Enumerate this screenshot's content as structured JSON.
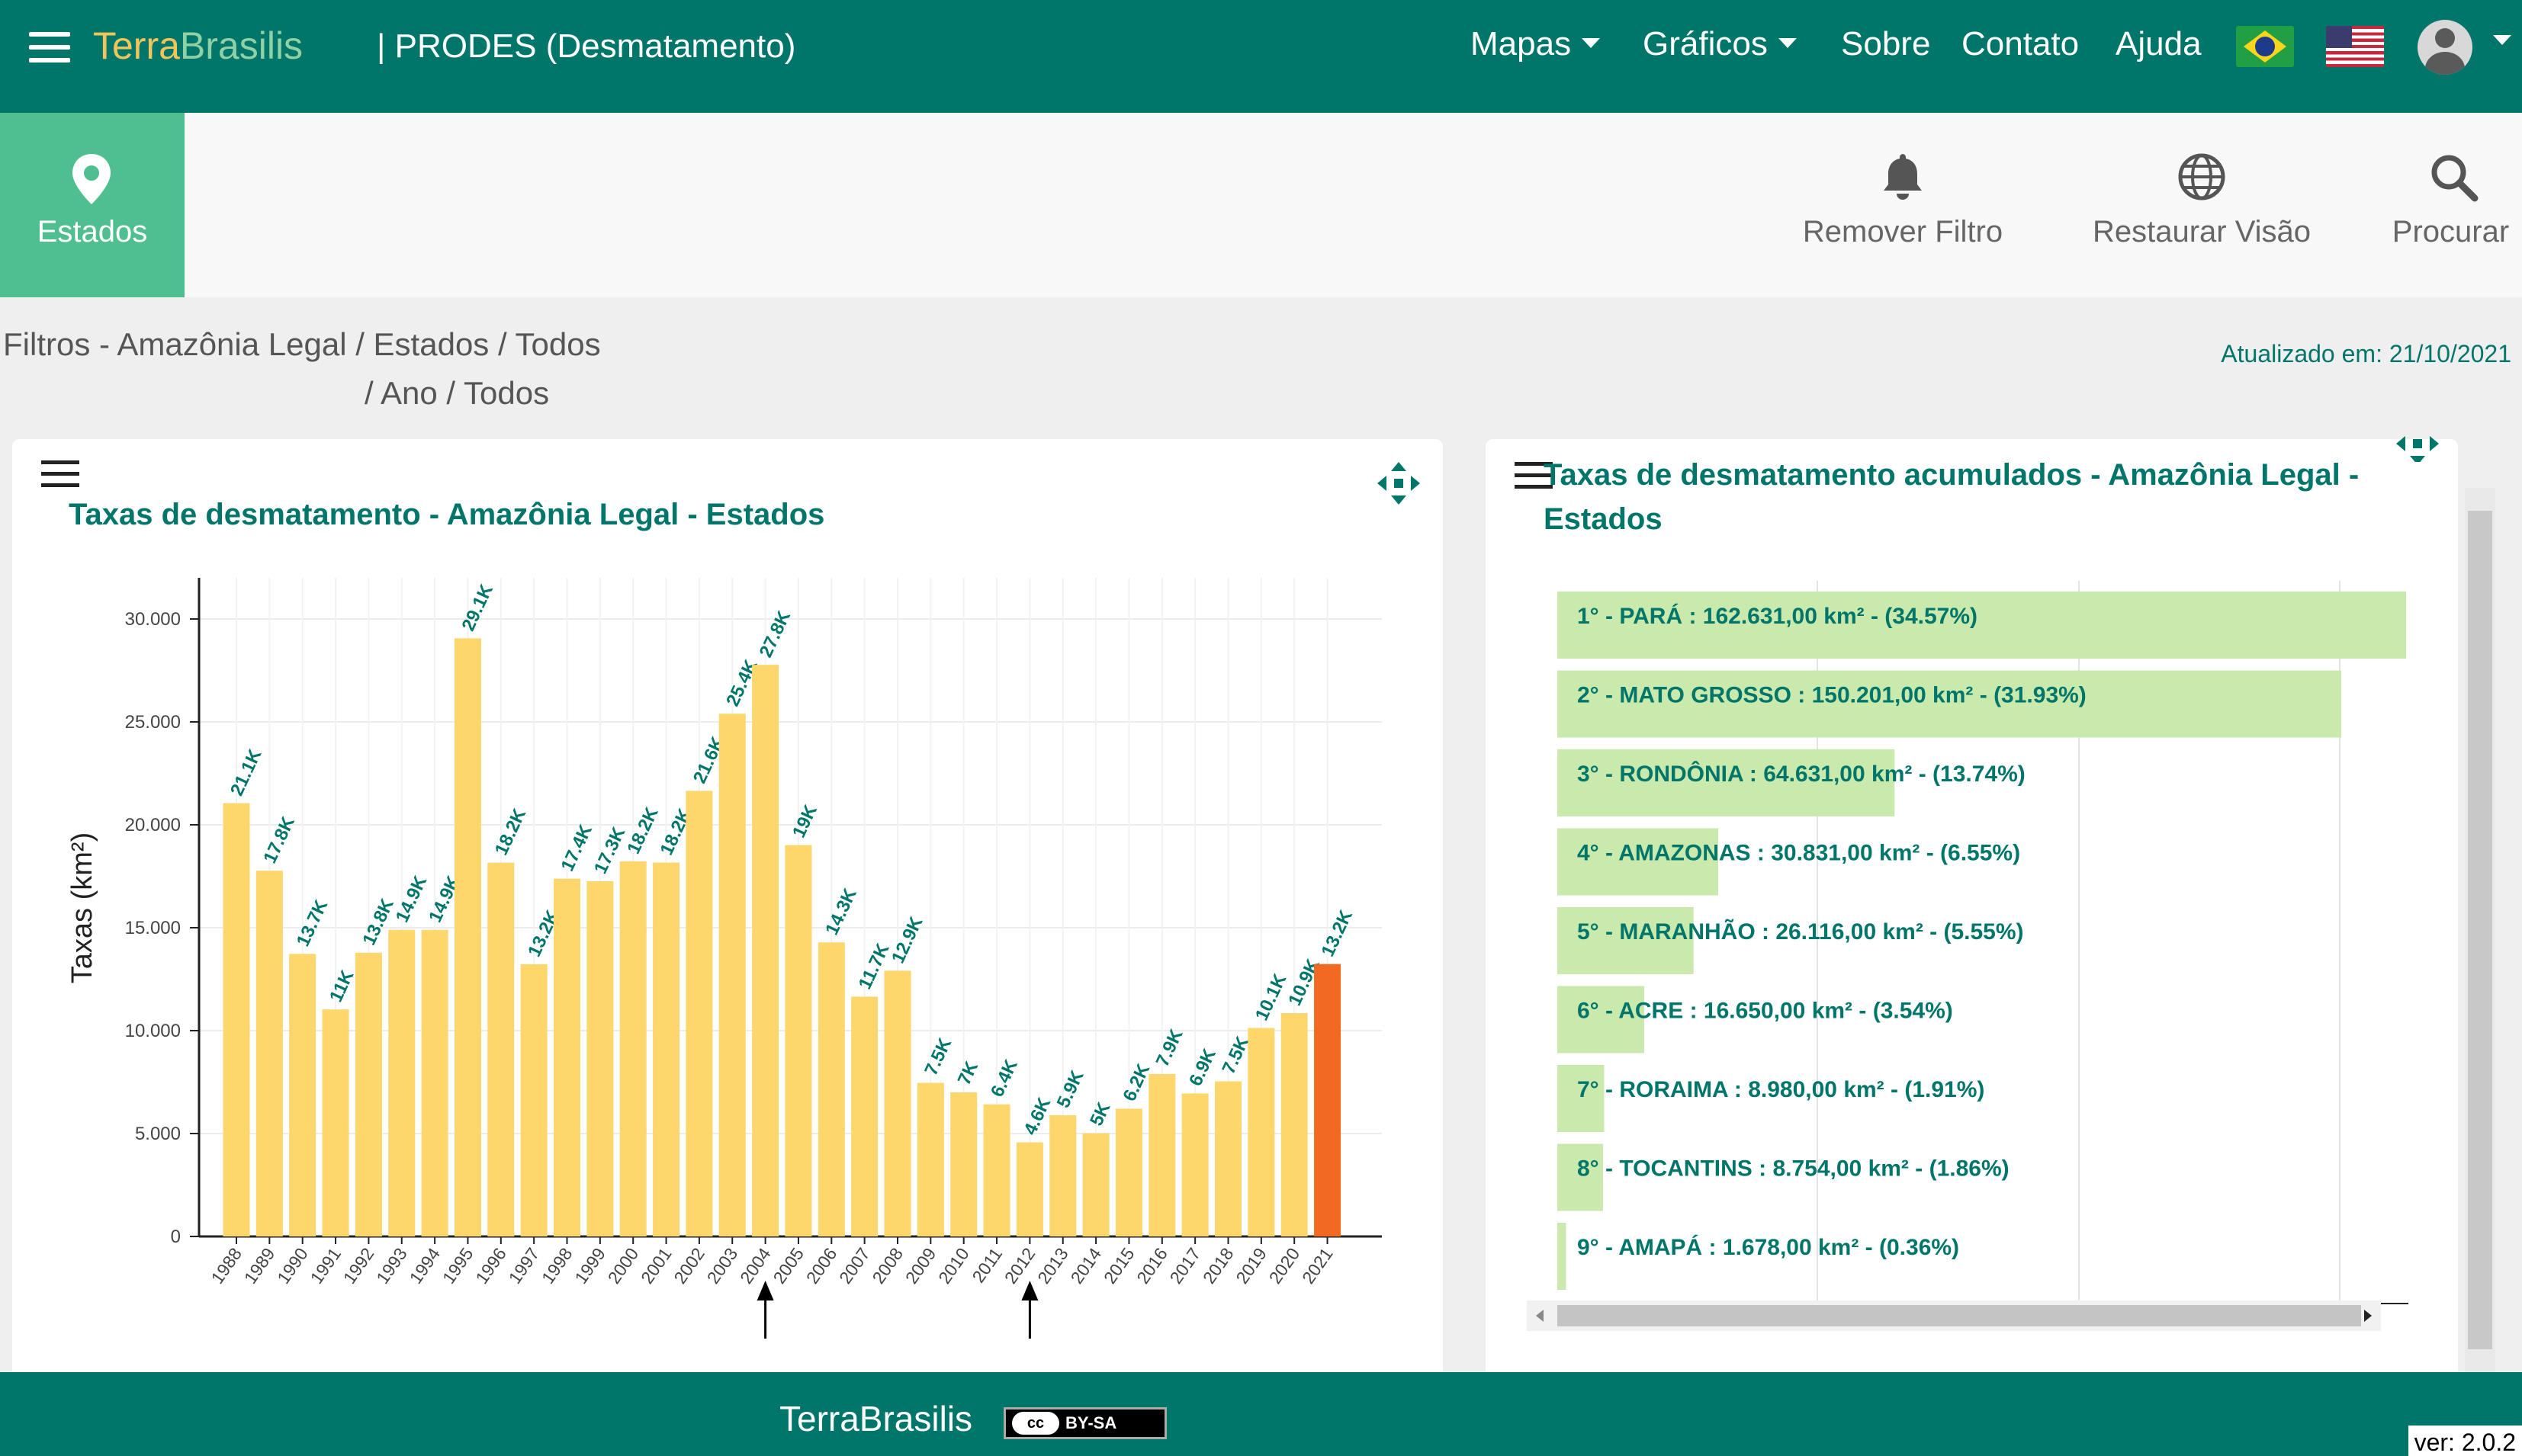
{
  "navbar": {
    "brand_part1": "Terra",
    "brand_part2": "Brasilis",
    "product": "| PRODES (Desmatamento)",
    "links": {
      "maps": "Mapas",
      "charts": "Gráficos",
      "about": "Sobre",
      "contact": "Contato",
      "help": "Ajuda"
    }
  },
  "toolbar": {
    "states": "Estados",
    "remove_filter": "Remover Filtro",
    "restore_view": "Restaurar Visão",
    "search": "Procurar"
  },
  "filters": {
    "line1": "Filtros - Amazônia Legal / Estados / Todos",
    "line2": "/ Ano / Todos",
    "updated": "Atualizado em: 21/10/2021"
  },
  "left_panel": {
    "title": "Taxas de desmatamento - Amazônia Legal - Estados"
  },
  "right_panel": {
    "title_line1": "Taxas de desmatamento acumulados - Amazônia Legal -",
    "title_line2": "Estados"
  },
  "colors": {
    "primary": "#00766a",
    "bar": "#fdd66c",
    "highlight_bar": "#f26a22",
    "hbar": "#c9e9ad",
    "states_tab": "#4fbf8f"
  },
  "chart_data": [
    {
      "type": "bar",
      "ylabel": "Taxas (km²)",
      "ylim": [
        0,
        32000
      ],
      "yticks": [
        0,
        5000,
        10000,
        15000,
        20000,
        25000,
        30000
      ],
      "ytick_labels": [
        "0",
        "5.000",
        "10.000",
        "15.000",
        "20.000",
        "25.000",
        "30.000"
      ],
      "categories": [
        "1988",
        "1989",
        "1990",
        "1991",
        "1992",
        "1993",
        "1994",
        "1995",
        "1996",
        "1997",
        "1998",
        "1999",
        "2000",
        "2001",
        "2002",
        "2003",
        "2004",
        "2005",
        "2006",
        "2007",
        "2008",
        "2009",
        "2010",
        "2011",
        "2012",
        "2013",
        "2014",
        "2015",
        "2016",
        "2017",
        "2018",
        "2019",
        "2020",
        "2021"
      ],
      "values": [
        21050,
        17770,
        13730,
        11030,
        13786,
        14896,
        14896,
        29059,
        18161,
        13227,
        17383,
        17259,
        18226,
        18165,
        21651,
        25396,
        27772,
        19014,
        14286,
        11651,
        12911,
        7464,
        7000,
        6418,
        4571,
        5891,
        5012,
        6207,
        7893,
        6947,
        7536,
        10129,
        10851,
        13235
      ],
      "data_labels": [
        "21.1K",
        "17.8K",
        "13.7K",
        "11K",
        "13.8K",
        "14.9K",
        "14.9K",
        "29.1K",
        "18.2K",
        "13.2K",
        "17.4K",
        "17.3K",
        "18.2K",
        "18.2K",
        "21.6K",
        "25.4K",
        "27.8K",
        "19K",
        "14.3K",
        "11.7K",
        "12.9K",
        "7.5K",
        "7K",
        "6.4K",
        "4.6K",
        "5.9K",
        "5K",
        "6.2K",
        "7.9K",
        "6.9K",
        "7.5K",
        "10.1K",
        "10.9K",
        "13.2K"
      ],
      "highlight": "2021",
      "markers": [
        "2004",
        "2012"
      ]
    },
    {
      "type": "bar",
      "orientation": "horizontal",
      "xlim": [
        0,
        162631
      ],
      "items": [
        {
          "label": "1° - PARÁ : 162.631,00 km² - (34.57%)",
          "value": 162631
        },
        {
          "label": "2° - MATO GROSSO : 150.201,00 km² - (31.93%)",
          "value": 150201
        },
        {
          "label": "3° - RONDÔNIA : 64.631,00 km² - (13.74%)",
          "value": 64631
        },
        {
          "label": "4° - AMAZONAS : 30.831,00 km² - (6.55%)",
          "value": 30831
        },
        {
          "label": "5° - MARANHÃO : 26.116,00 km² - (5.55%)",
          "value": 26116
        },
        {
          "label": "6° - ACRE : 16.650,00 km² - (3.54%)",
          "value": 16650
        },
        {
          "label": "7° - RORAIMA : 8.980,00 km² - (1.91%)",
          "value": 8980
        },
        {
          "label": "8° - TOCANTINS : 8.754,00 km² - (1.86%)",
          "value": 8754
        },
        {
          "label": "9° - AMAPÁ : 1.678,00 km² - (0.36%)",
          "value": 1678
        }
      ]
    }
  ],
  "footer": {
    "brand": "TerraBrasilis",
    "license": "BY-SA",
    "cc": "cc",
    "version": "ver: 2.0.2"
  }
}
